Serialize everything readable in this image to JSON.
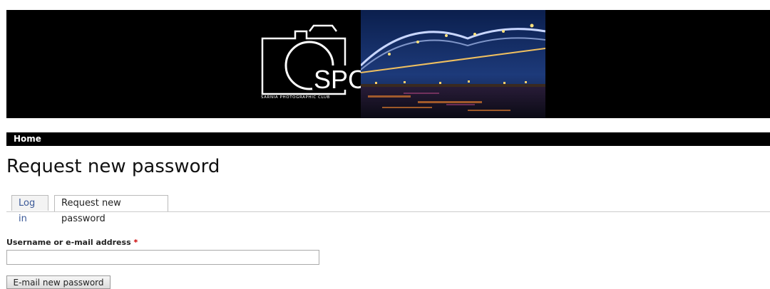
{
  "header": {
    "logo_text": "SPC",
    "logo_caption": "SARNIA PHOTOGRAPHIC CLUB"
  },
  "nav": {
    "home_label": "Home"
  },
  "page": {
    "title": "Request new password"
  },
  "tabs": [
    {
      "label": "Log in",
      "active": false
    },
    {
      "label": "Request new password",
      "active": true
    }
  ],
  "form": {
    "username_label": "Username or e-mail address",
    "required_marker": "*",
    "username_value": "",
    "submit_label": "E-mail new password"
  },
  "colors": {
    "banner_bg": "#000000",
    "link": "#3b5998",
    "required": "#cc0000"
  }
}
